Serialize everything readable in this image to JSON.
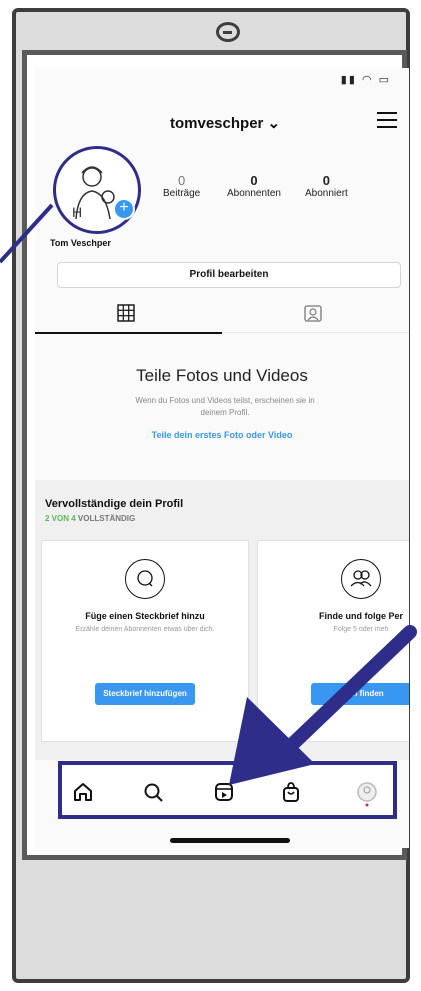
{
  "profile": {
    "username": "tomveschper",
    "username_chevron": "⌄",
    "display_name": "Tom Veschper",
    "stats": [
      {
        "value": "0",
        "label": "Beiträge"
      },
      {
        "value": "0",
        "label": "Abonnenten"
      },
      {
        "value": "0",
        "label": "Abonniert"
      }
    ],
    "edit_button": "Profil bearbeiten"
  },
  "empty_state": {
    "title": "Teile Fotos und Videos",
    "description": "Wenn du Fotos und Videos teilst, erscheinen sie in deinem Profil.",
    "link": "Teile dein erstes Foto oder Video"
  },
  "complete_profile": {
    "title": "Vervollständige dein Profil",
    "progress_highlight": "2 VON 4",
    "progress_rest": " VOLLSTÄNDIG",
    "cards": [
      {
        "title": "Füge einen Steckbrief hinzu",
        "description": "Erzähle deinen Abonnenten etwas über dich.",
        "button": "Steckbrief hinzufügen"
      },
      {
        "title": "Finde und folge Per",
        "description": "Folge 5 oder meh",
        "button": "onen finden"
      }
    ]
  },
  "nav": [
    "home-icon",
    "search-icon",
    "reels-icon",
    "shop-icon",
    "profile-avatar-icon"
  ],
  "colors": {
    "accent": "#3897f0",
    "annotation": "#2e2e8a",
    "progress_green": "#5cb85c"
  }
}
